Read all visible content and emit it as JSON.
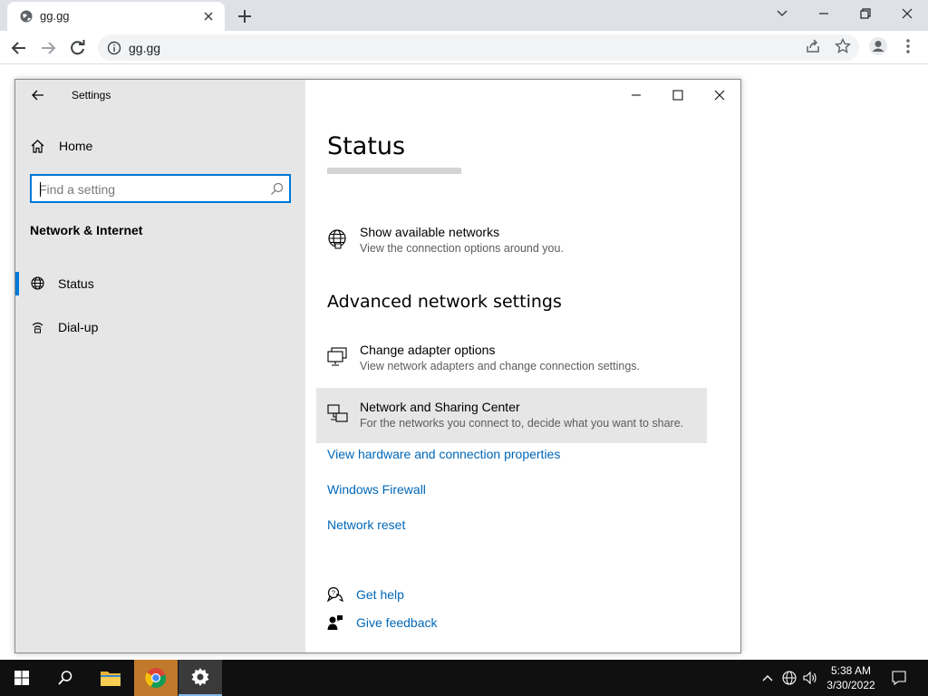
{
  "browser": {
    "tab_title": "gg.gg",
    "url": "gg.gg"
  },
  "settings": {
    "app_title": "Settings",
    "home_label": "Home",
    "search_placeholder": "Find a setting",
    "section_heading": "Network & Internet",
    "nav_items": [
      {
        "label": "Status",
        "icon": "globe-icon",
        "selected": true
      },
      {
        "label": "Dial-up",
        "icon": "dialup-icon",
        "selected": false
      }
    ],
    "page_title": "Status",
    "show_networks": {
      "title": "Show available networks",
      "desc": "View the connection options around you."
    },
    "advanced_heading": "Advanced network settings",
    "adapter": {
      "title": "Change adapter options",
      "desc": "View network adapters and change connection settings."
    },
    "sharing": {
      "title": "Network and Sharing Center",
      "desc": "For the networks you connect to, decide what you want to share."
    },
    "links": [
      "View hardware and connection properties",
      "Windows Firewall",
      "Network reset"
    ],
    "get_help": "Get help",
    "give_feedback": "Give feedback"
  },
  "taskbar": {
    "time": "5:38 AM",
    "date": "3/30/2022"
  },
  "colors": {
    "accent": "#0078d7",
    "link": "#0067b8"
  }
}
